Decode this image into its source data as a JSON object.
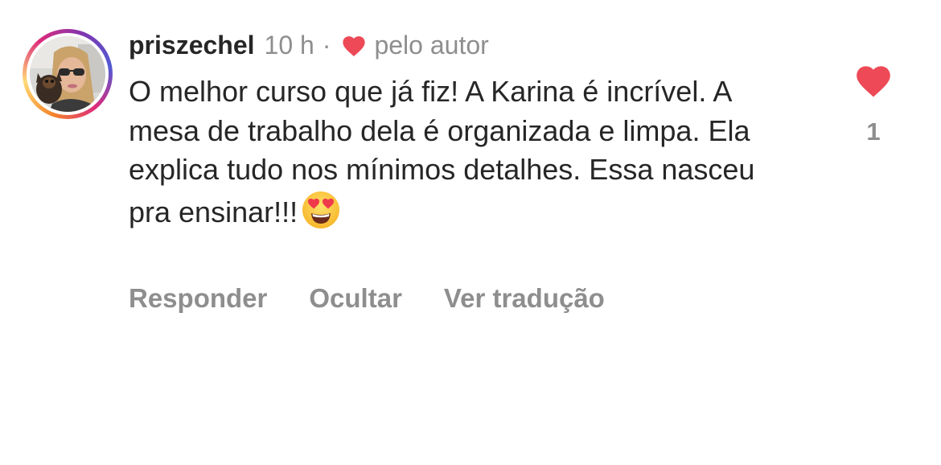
{
  "colors": {
    "text": "#262626",
    "secondary": "#8e8e8e",
    "like_red": "#ed4956"
  },
  "comment": {
    "avatar_icon": "profile-photo",
    "username": "priszechel",
    "time": "10 h",
    "separator": "·",
    "author_heart_icon": "heart-icon",
    "liked_by_author_label": "pelo autor",
    "text": "O melhor curso que já fiz! A Karina é incrível. A mesa de trabalho dela é organizada e limpa. Ela explica tudo nos mínimos detalhes. Essa nasceu pra ensinar!!!",
    "emoji": "smiling-face-with-heart-eyes"
  },
  "actions": {
    "reply_label": "Responder",
    "hide_label": "Ocultar",
    "translate_label": "Ver tradução"
  },
  "like": {
    "icon": "heart-filled-icon",
    "count": "1",
    "liked": true
  }
}
